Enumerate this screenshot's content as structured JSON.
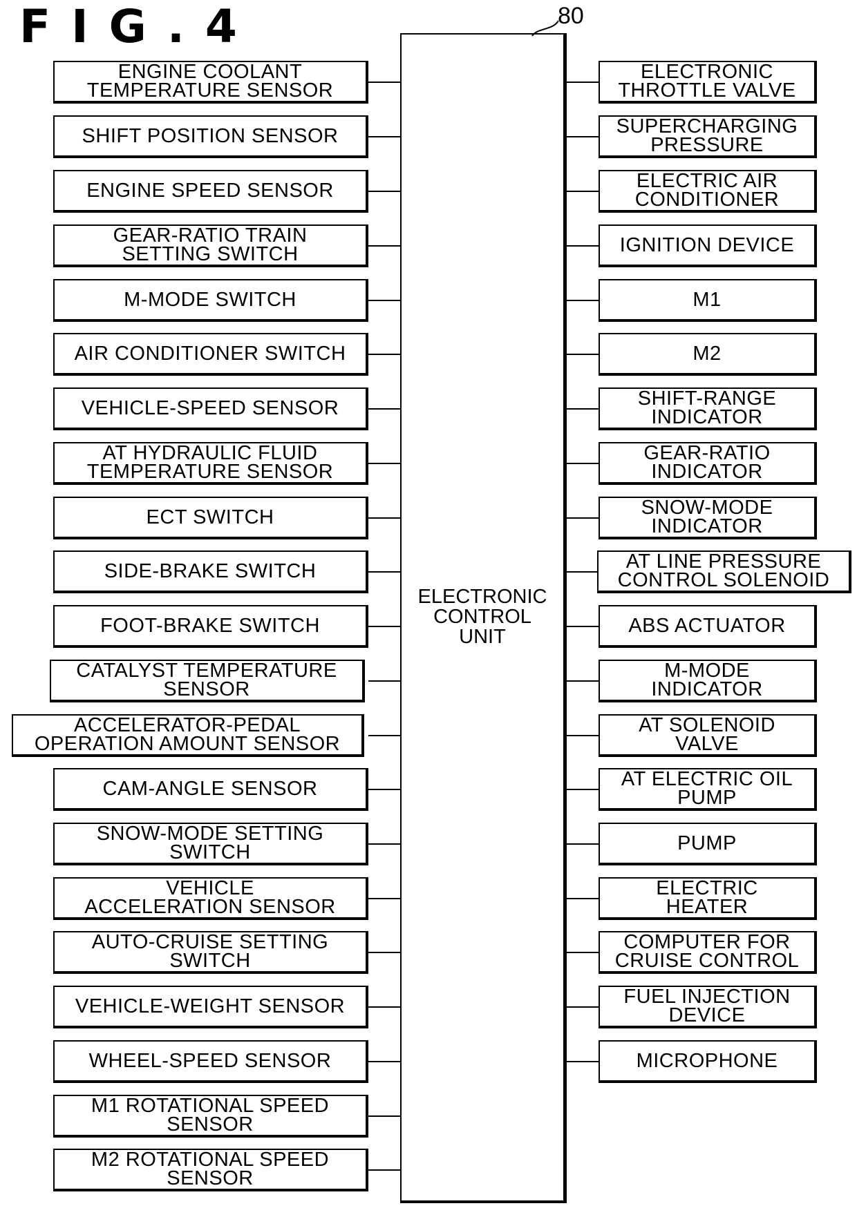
{
  "figure": {
    "title": "FIG.4",
    "reference_number": "80"
  },
  "ecu": {
    "label": "ELECTRONIC\nCONTROL\nUNIT"
  },
  "inputs": [
    {
      "label": "ENGINE COOLANT\nTEMPERATURE SENSOR"
    },
    {
      "label": "SHIFT POSITION SENSOR"
    },
    {
      "label": "ENGINE SPEED SENSOR"
    },
    {
      "label": "GEAR-RATIO TRAIN\nSETTING SWITCH"
    },
    {
      "label": "M-MODE SWITCH"
    },
    {
      "label": "AIR CONDITIONER SWITCH"
    },
    {
      "label": "VEHICLE-SPEED SENSOR"
    },
    {
      "label": "AT HYDRAULIC FLUID\nTEMPERATURE SENSOR"
    },
    {
      "label": "ECT SWITCH"
    },
    {
      "label": "SIDE-BRAKE SWITCH"
    },
    {
      "label": "FOOT-BRAKE SWITCH"
    },
    {
      "label": "CATALYST TEMPERATURE\nSENSOR"
    },
    {
      "label": "ACCELERATOR-PEDAL\nOPERATION AMOUNT SENSOR"
    },
    {
      "label": "CAM-ANGLE SENSOR"
    },
    {
      "label": "SNOW-MODE SETTING\nSWITCH"
    },
    {
      "label": "VEHICLE\nACCELERATION SENSOR"
    },
    {
      "label": "AUTO-CRUISE SETTING\nSWITCH"
    },
    {
      "label": "VEHICLE-WEIGHT SENSOR"
    },
    {
      "label": "WHEEL-SPEED SENSOR"
    },
    {
      "label": "M1 ROTATIONAL SPEED\nSENSOR"
    },
    {
      "label": "M2 ROTATIONAL SPEED\nSENSOR"
    }
  ],
  "outputs": [
    {
      "label": "ELECTRONIC\nTHROTTLE VALVE"
    },
    {
      "label": "SUPERCHARGING\nPRESSURE"
    },
    {
      "label": "ELECTRIC AIR\nCONDITIONER"
    },
    {
      "label": "IGNITION DEVICE"
    },
    {
      "label": "M1"
    },
    {
      "label": "M2"
    },
    {
      "label": "SHIFT-RANGE\nINDICATOR"
    },
    {
      "label": "GEAR-RATIO\nINDICATOR"
    },
    {
      "label": "SNOW-MODE\nINDICATOR"
    },
    {
      "label": "AT LINE PRESSURE\nCONTROL SOLENOID"
    },
    {
      "label": "ABS ACTUATOR"
    },
    {
      "label": "M-MODE\nINDICATOR"
    },
    {
      "label": "AT SOLENOID\nVALVE"
    },
    {
      "label": "AT ELECTRIC OIL\nPUMP"
    },
    {
      "label": "PUMP"
    },
    {
      "label": "ELECTRIC\nHEATER"
    },
    {
      "label": "COMPUTER FOR\nCRUISE CONTROL"
    },
    {
      "label": "FUEL INJECTION\nDEVICE"
    },
    {
      "label": "MICROPHONE"
    }
  ]
}
